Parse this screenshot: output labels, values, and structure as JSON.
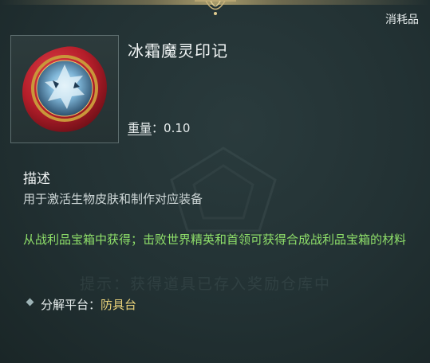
{
  "tooltip": {
    "category": "消耗品",
    "item_name": "冰霜魔灵印记",
    "weight_label": "重量",
    "weight_sep": "：",
    "weight_value": "0.10",
    "section_title": "描述",
    "description": "用于激活生物皮肤和制作对应装备",
    "source_text": "从战利品宝箱中获得；击败世界精英和首领可获得合成战利品宝箱的材料",
    "watermark_text": "提示：获得道具已存入奖励仓库中",
    "dismantle_label": "分解平台：",
    "dismantle_value": "防具台",
    "icon": "frost-seal-icon",
    "colors": {
      "source_text": "#8fe06a",
      "dismantle_value": "#e9d27a",
      "seal_red": "#c0222e",
      "seal_gold": "#c9973a",
      "seal_ice": "#7fb6d8"
    }
  }
}
